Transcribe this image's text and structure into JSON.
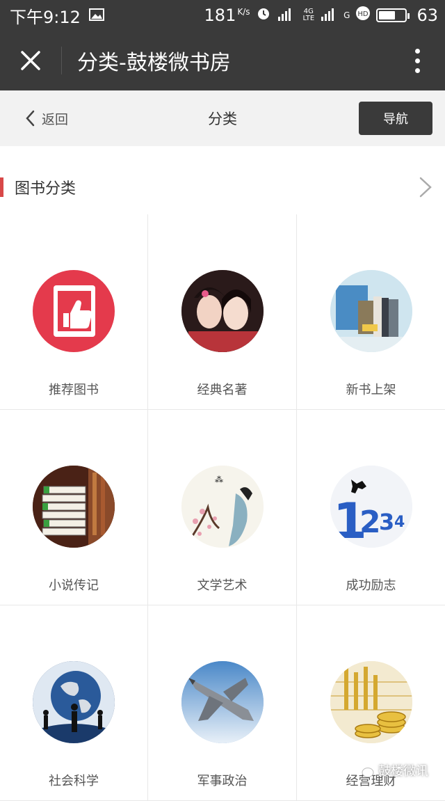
{
  "status": {
    "time": "下午9:12",
    "speed": "181",
    "speed_unit": "K/s",
    "net1": "4G",
    "net1_sub": "LTE",
    "net2": "G",
    "battery": "63",
    "battery_level": 0.63
  },
  "titlebar": {
    "title": "分类-鼓楼微书房"
  },
  "navbar": {
    "back_label": "返回",
    "title": "分类",
    "nav_button": "导航"
  },
  "section": {
    "title": "图书分类"
  },
  "categories": [
    {
      "label": "推荐图书",
      "icon": "thumbs-up-book-icon"
    },
    {
      "label": "经典名著",
      "icon": "classic-portrait-icon"
    },
    {
      "label": "新书上架",
      "icon": "new-books-icon"
    },
    {
      "label": "小说传记",
      "icon": "stacked-books-icon"
    },
    {
      "label": "文学艺术",
      "icon": "ink-painting-icon"
    },
    {
      "label": "成功励志",
      "icon": "climbing-numbers-icon"
    },
    {
      "label": "社会科学",
      "icon": "globe-people-icon"
    },
    {
      "label": "军事政治",
      "icon": "fighter-jet-icon"
    },
    {
      "label": "经营理财",
      "icon": "gold-coins-icon"
    }
  ],
  "watermark": {
    "text": "鼓楼微讯"
  },
  "colors": {
    "bar_dark": "#3a3a3a",
    "accent_red": "#d84848",
    "nav_bg": "#f2f2f2"
  }
}
